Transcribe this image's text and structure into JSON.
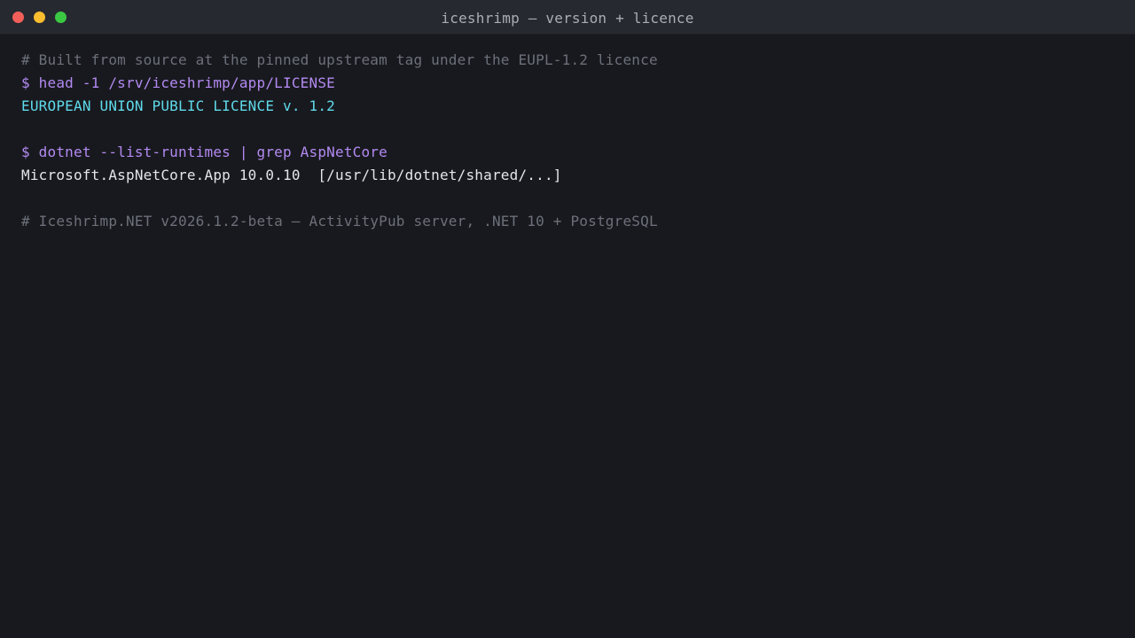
{
  "window": {
    "title": "iceshrimp — version + licence"
  },
  "terminal": {
    "lines": [
      {
        "kind": "comment",
        "text": "# Built from source at the pinned upstream tag under the EUPL-1.2 licence"
      },
      {
        "kind": "command",
        "text": "$ head -1 /srv/iceshrimp/app/LICENSE"
      },
      {
        "kind": "highlight",
        "text": "EUROPEAN UNION PUBLIC LICENCE v. 1.2"
      },
      {
        "kind": "blank",
        "text": ""
      },
      {
        "kind": "command",
        "text": "$ dotnet --list-runtimes | grep AspNetCore"
      },
      {
        "kind": "output",
        "text": "Microsoft.AspNetCore.App 10.0.10  [/usr/lib/dotnet/shared/...]"
      },
      {
        "kind": "blank",
        "text": ""
      },
      {
        "kind": "comment",
        "text": "# Iceshrimp.NET v2026.1.2-beta — ActivityPub server, .NET 10 + PostgreSQL"
      }
    ]
  },
  "colors": {
    "background": "#18191e",
    "titlebar": "#262930",
    "comment": "#6c707a",
    "command": "#b38af2",
    "highlight": "#5fdaeb",
    "output": "#e3e5ea"
  }
}
